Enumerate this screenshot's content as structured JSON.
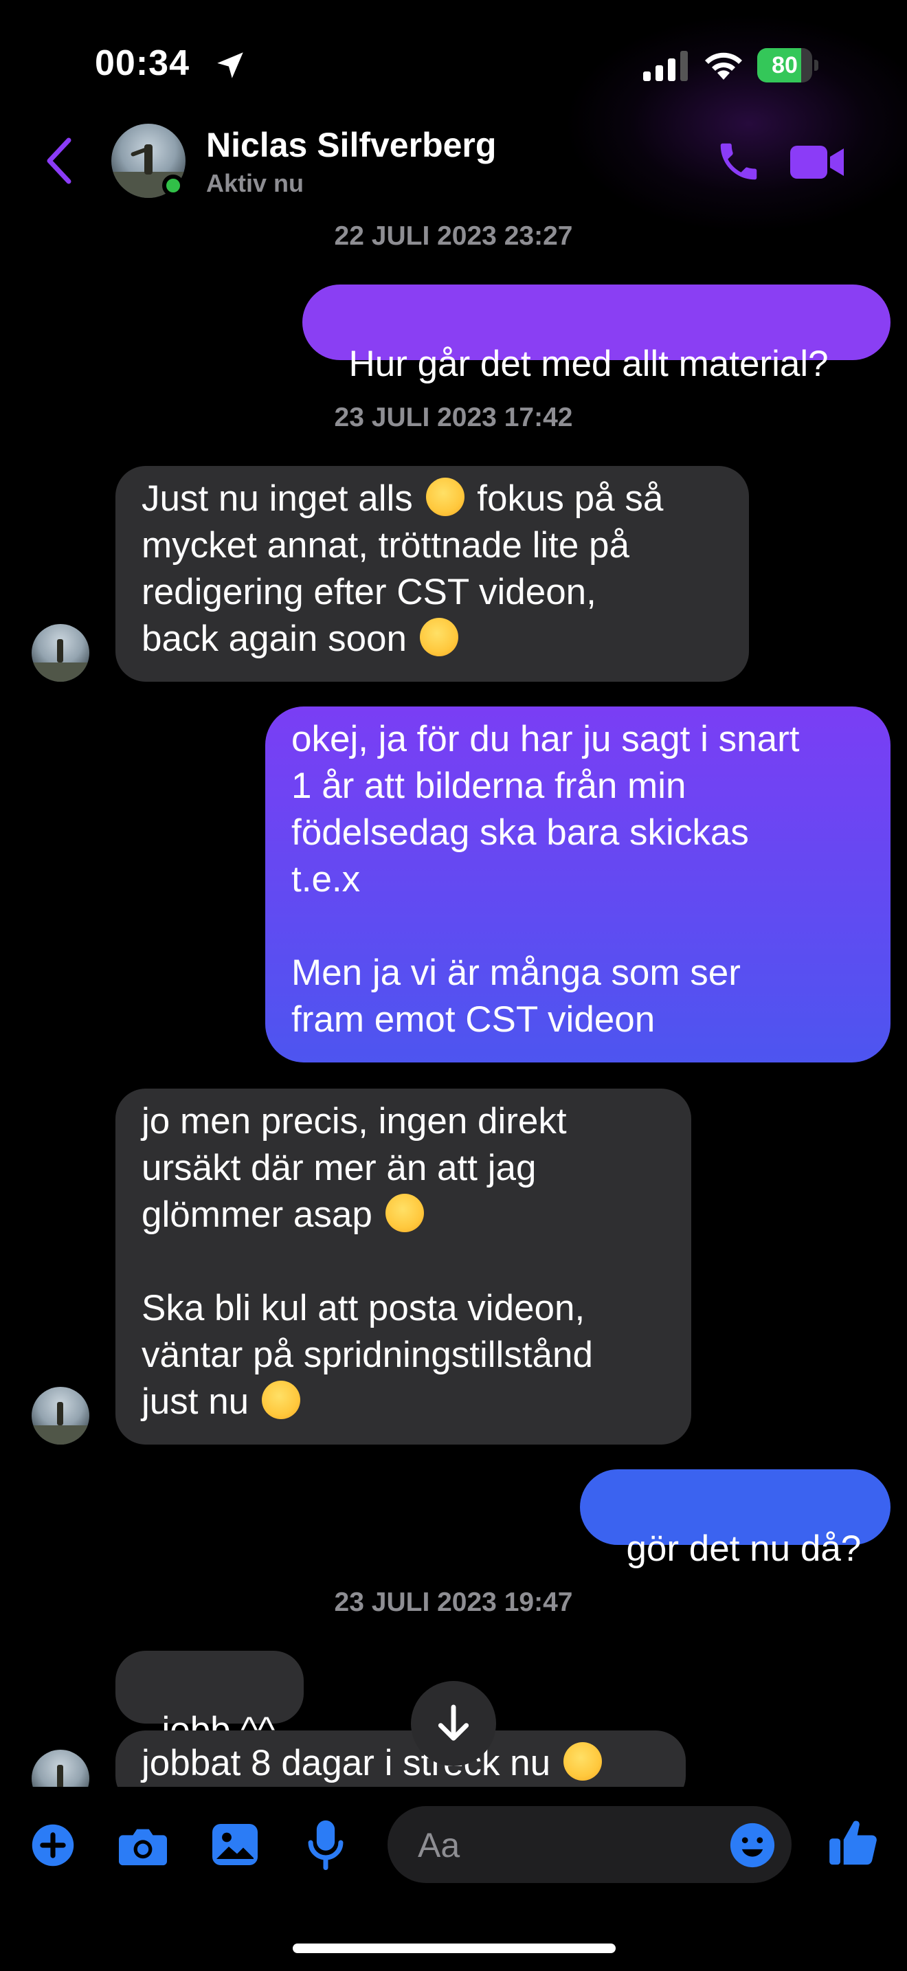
{
  "status_bar": {
    "time": "00:34",
    "battery": "80",
    "battery_level": 0.8
  },
  "header": {
    "name": "Niclas Silfverberg",
    "status": "Aktiv nu"
  },
  "timestamps": [
    "22 JULI 2023 23:27",
    "23 JULI 2023 17:42",
    "23 JULI 2023 19:47"
  ],
  "messages": {
    "m1": {
      "text": "Hur går det med allt material?"
    },
    "m2": {
      "l1": "Just nu inget alls ",
      "l1b": " fokus på så",
      "l2": "mycket annat, tröttnade lite på",
      "l3": "redigering efter CST videon,",
      "l4": "back again soon ",
      "emoji": "slightly-smiling-face"
    },
    "m3": {
      "l1": "okej, ja för du har ju sagt i snart",
      "l2": "1 år att bilderna från min",
      "l3": "födelsedag ska bara skickas",
      "l4": "t.e.x",
      "l5": "Men ja vi är många som ser",
      "l6": "fram emot CST videon"
    },
    "m4": {
      "l1": "jo men precis, ingen direkt",
      "l2": "ursäkt där mer än att jag",
      "l3": "glömmer asap ",
      "l4": "Ska bli kul att posta videon,",
      "l5": "väntar på spridningstillstånd",
      "l6": "just nu ",
      "emoji1": "melting-face",
      "emoji2": "slightly-smiling-face"
    },
    "m5": {
      "text": "gör det nu då?"
    },
    "m6": {
      "text": "jobb ^^"
    },
    "m7": {
      "text": "jobbat 8 dagar i streck nu ",
      "emoji": "winking-face"
    }
  },
  "composer": {
    "placeholder": "Aa",
    "icons": [
      "plus-icon",
      "camera-icon",
      "image-icon",
      "microphone-icon",
      "emoji-icon",
      "thumbs-up-icon"
    ]
  },
  "colors": {
    "accent": "#8b3cf7",
    "out_top": "#8a3ff3",
    "out_bottom": "#3b63f0",
    "incoming": "#2f2f31",
    "composer_blue": "#2b7cf6"
  }
}
